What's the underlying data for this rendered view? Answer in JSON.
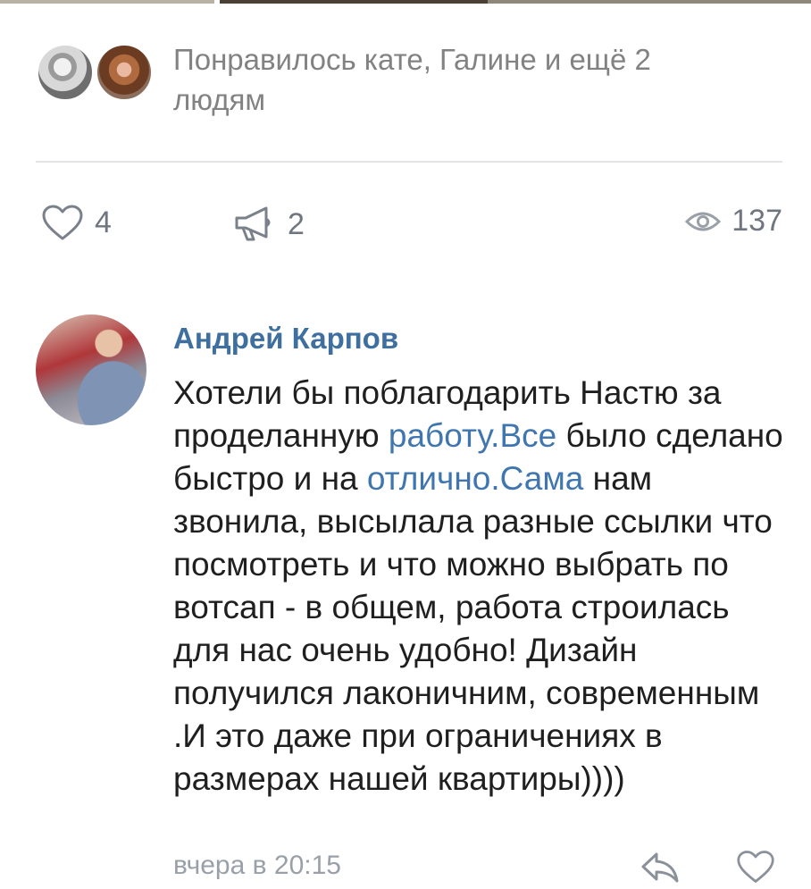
{
  "likes_summary": {
    "text": "Понравилось кате, Галине и ещё 2 людям"
  },
  "post_actions": {
    "likes_count": "4",
    "shares_count": "2",
    "views_count": "137"
  },
  "comment": {
    "author": "Андрей Карпов",
    "text_parts": {
      "p1": "Хотели бы поблагодарить  Настю за проделанную ",
      "link1": "работу.Все",
      "p2": " было сделано быстро и на ",
      "link2": "отлично.Сама",
      "p3": " нам звонила, высылала разные ссылки что посмотреть и что можно выбрать по вотсап - в общем, работа строилась для нас очень удобно! Дизайн получился лаконичним, современным .И это даже при ограничениях в размерах нашей квартиры))))"
    },
    "timestamp": "вчера в 20:15"
  },
  "icons": {
    "like": "heart-icon",
    "share": "megaphone-icon",
    "views": "eye-icon",
    "reply": "reply-icon",
    "comment_like": "heart-icon"
  },
  "colors": {
    "link": "#3f76b0",
    "author_name": "#3f6f9e",
    "muted_text": "#828282",
    "icon_gray": "#6f7680"
  }
}
